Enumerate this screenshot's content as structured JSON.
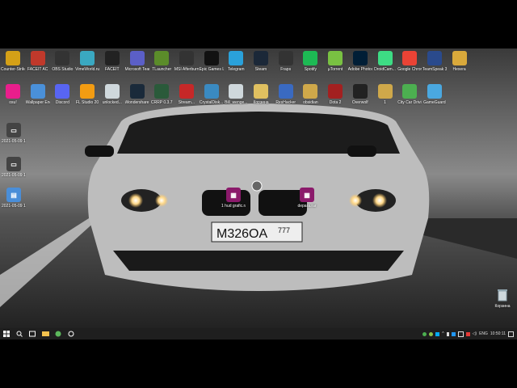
{
  "desktop": {
    "row1": [
      {
        "label": "Counter-Strike Global Offe..."
      },
      {
        "label": "FACEIT AC"
      },
      {
        "label": "OBS Studio"
      },
      {
        "label": "VimeWorld.ru"
      },
      {
        "label": "FACEIT"
      },
      {
        "label": "Microsoft Teams"
      },
      {
        "label": "TLauncher"
      },
      {
        "label": "MSI Afterburner"
      },
      {
        "label": "Epic Games Launcher"
      },
      {
        "label": "Telegram"
      },
      {
        "label": "Steam"
      },
      {
        "label": "Fraps"
      },
      {
        "label": "Spotify"
      },
      {
        "label": "µTorrent"
      },
      {
        "label": "Adobe Photosh..."
      },
      {
        "label": "DroidCam..."
      },
      {
        "label": "Google Chrome"
      },
      {
        "label": "TeamSpeak 3 Client"
      },
      {
        "label": "Hexera"
      }
    ],
    "row2": [
      {
        "label": "osu!"
      },
      {
        "label": "Wallpaper Engine"
      },
      {
        "label": "Discord"
      },
      {
        "label": "FL Studio 20"
      },
      {
        "label": "unlocked..."
      },
      {
        "label": "Wondershare Filmora X"
      },
      {
        "label": "CRRP 0.3.7"
      },
      {
        "label": "Stream..."
      },
      {
        "label": "CrystalDisk..."
      },
      {
        "label": "Bill_wenge..."
      },
      {
        "label": "Корзина"
      },
      {
        "label": "ResHacker"
      },
      {
        "label": "obsidian"
      },
      {
        "label": "Dota 2"
      },
      {
        "label": "Overwolf"
      },
      {
        "label": "1"
      },
      {
        "label": "City Car Driving"
      },
      {
        "label": "GameGuard"
      }
    ],
    "left_files": [
      {
        "label": "2021-05-09 19-05-..."
      },
      {
        "label": "2021-05-09 19-05-..."
      },
      {
        "label": "2021-05-09 19-29-20..."
      }
    ],
    "center_files": [
      {
        "label": "1 hud grafic.rar"
      },
      {
        "label": "depara.rar"
      }
    ],
    "trash": {
      "label": "Корзина"
    }
  },
  "wallpaper": {
    "plate": "M326OA",
    "region": "777"
  },
  "taskbar": {
    "lang": "ENG",
    "time": "10:50:11",
    "colors": {
      "bar": "#1f1f1f"
    }
  }
}
